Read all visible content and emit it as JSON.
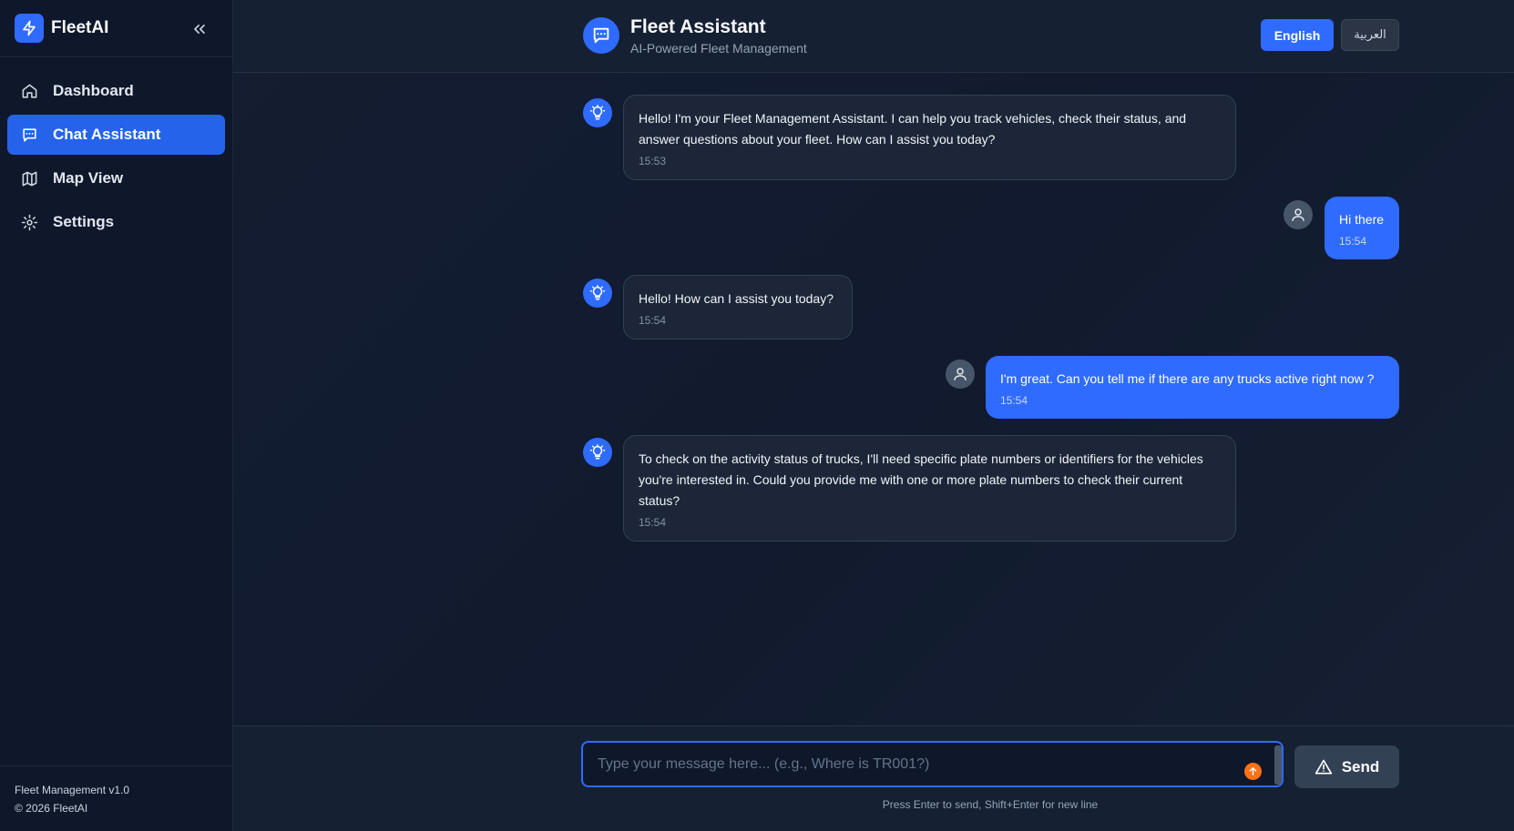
{
  "brand": {
    "name": "FleetAI",
    "accent": "#2f6bff"
  },
  "sidebar": {
    "items": [
      {
        "label": "Dashboard",
        "icon": "home-icon",
        "active": false
      },
      {
        "label": "Chat Assistant",
        "icon": "chat-icon",
        "active": true
      },
      {
        "label": "Map View",
        "icon": "map-icon",
        "active": false
      },
      {
        "label": "Settings",
        "icon": "gear-icon",
        "active": false
      }
    ],
    "footer": {
      "version": "Fleet Management v1.0",
      "copyright": "© 2026 FleetAI"
    }
  },
  "header": {
    "title": "Fleet Assistant",
    "subtitle": "AI-Powered Fleet Management",
    "languages": [
      "English",
      "العربية"
    ],
    "selected_language": "English"
  },
  "messages": [
    {
      "role": "bot",
      "text": "Hello! I'm your Fleet Management Assistant. I can help you track vehicles, check their status, and answer questions about your fleet. How can I assist you today?",
      "time": "15:53"
    },
    {
      "role": "user",
      "text": "Hi there",
      "time": "15:54"
    },
    {
      "role": "bot",
      "text": "Hello! How can I assist you today?",
      "time": "15:54"
    },
    {
      "role": "user",
      "text": "I'm great. Can you tell me if there are any trucks active right now ?",
      "time": "15:54"
    },
    {
      "role": "bot",
      "text": "To check on the activity status of trucks, I'll need specific plate numbers or identifiers for the vehicles you're interested in. Could you provide me with one or more plate numbers to check their current status?",
      "time": "15:54"
    }
  ],
  "composer": {
    "placeholder": "Type your message here... (e.g., Where is TR001?)",
    "value": "",
    "send_label": "Send",
    "hint": "Press Enter to send, Shift+Enter for new line"
  }
}
